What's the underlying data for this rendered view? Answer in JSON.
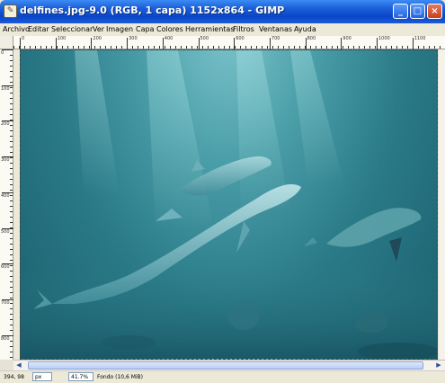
{
  "window": {
    "title": "delfines.jpg-9.0 (RGB, 1 capa) 1152x864 - GIMP",
    "app_icon": "gimp-icon",
    "buttons": {
      "minimize": "_",
      "maximize": "□",
      "close": "×"
    }
  },
  "menubar": {
    "items": [
      {
        "label": "Archivo"
      },
      {
        "label": "Editar"
      },
      {
        "label": "Seleccionar"
      },
      {
        "label": "Ver"
      },
      {
        "label": "Imagen"
      },
      {
        "label": "Capa"
      },
      {
        "label": "Colores"
      },
      {
        "label": "Herramientas"
      },
      {
        "label": "Filtros"
      },
      {
        "label": "Ventanas"
      },
      {
        "label": "Ayuda"
      }
    ]
  },
  "rulers": {
    "horizontal_labels": [
      "0",
      "100",
      "200",
      "300",
      "400",
      "500",
      "600",
      "700",
      "800",
      "900",
      "1000",
      "1100"
    ],
    "vertical_labels": [
      "0",
      "100",
      "200",
      "300",
      "400",
      "500",
      "600",
      "700",
      "800"
    ]
  },
  "canvas": {
    "image_description_icon": "dolphins-image"
  },
  "statusbar": {
    "coordinates": "394, 98",
    "unit": "px",
    "zoom": "41.7%",
    "layer_info": "Fondo (10,6 MiB)"
  },
  "colors": {
    "title_bar": "#0a46c8",
    "water_light": "#7fc6cd",
    "water_dark": "#1b5f6e"
  }
}
